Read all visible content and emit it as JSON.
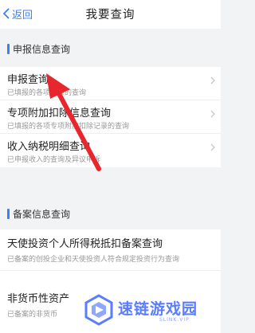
{
  "header": {
    "back_label": "返回",
    "title": "我要查询"
  },
  "sections": [
    {
      "title": "申报信息查询",
      "items": [
        {
          "title": "申报查询",
          "subtitle": "已填报的各项报表的查询"
        },
        {
          "title": "专项附加扣除信息查询",
          "subtitle": "已填报的各项专项附加扣除记录的查询"
        },
        {
          "title": "收入纳税明细查询",
          "subtitle": "已申报收入的查询及异议申诉"
        }
      ]
    },
    {
      "title": "备案信息查询",
      "items": [
        {
          "title": "天使投资个人所得税抵扣备案查询",
          "subtitle": "已备案的创投企业和天使投资人符合规定投资行为查询"
        },
        {
          "title": "非货币性资产",
          "subtitle": "已备案的非货币"
        }
      ]
    }
  ],
  "watermark": {
    "name": "速链游戏园",
    "url": "SLINK.VIP"
  },
  "colors": {
    "accent": "#3b7ff5",
    "annotation_arrow": "#e8262d",
    "watermark": "#5a7cff"
  }
}
